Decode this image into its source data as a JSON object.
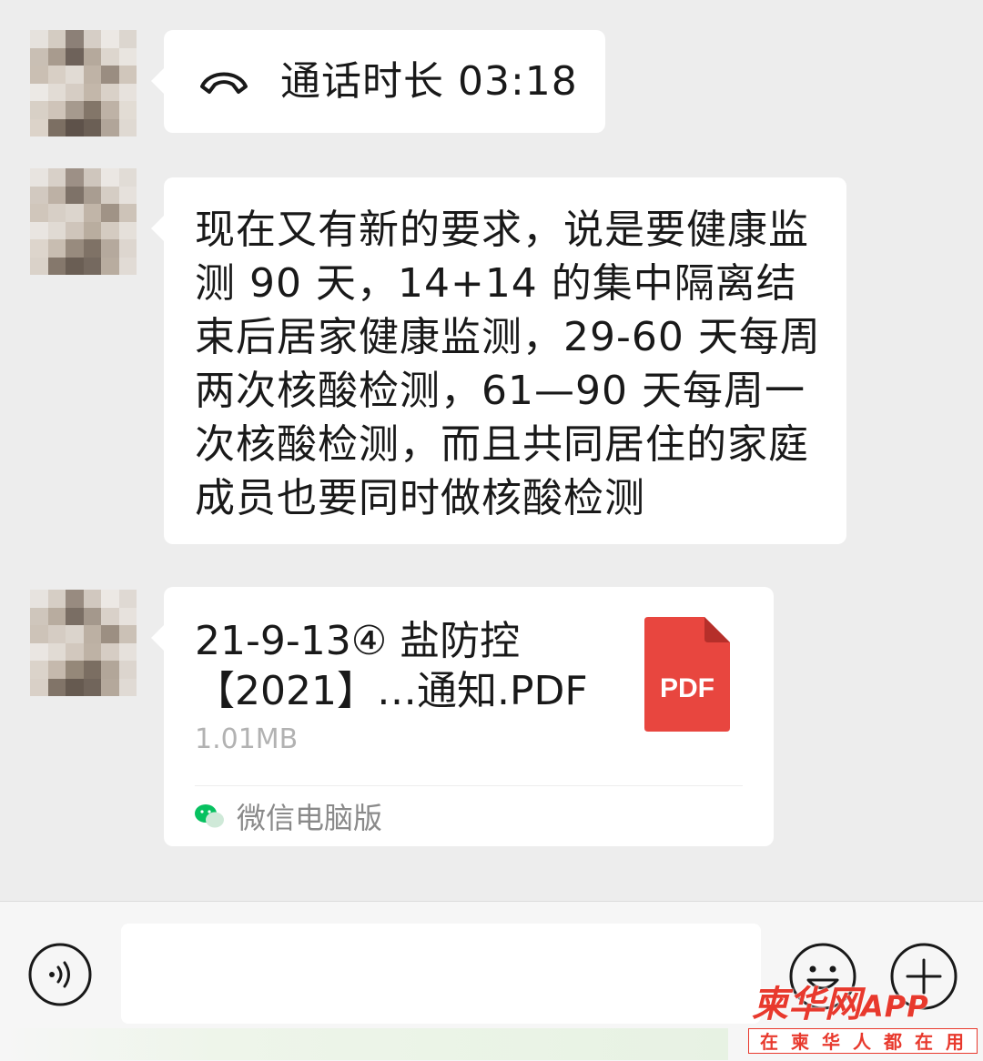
{
  "chat": {
    "call": {
      "text": "通话时长 03:18"
    },
    "message": {
      "text": "现在又有新的要求，说是要健康监测 90 天，14+14 的集中隔离结束后居家健康监测，29-60 天每周两次核酸检测，61—90 天每周一次核酸检测，而且共同居住的家庭成员也要同时做核酸检测"
    },
    "file": {
      "name_line1": "21-9-13④ 盐防控",
      "name_line2": "【2021】…通知.PDF",
      "size": "1.01MB",
      "type_label": "PDF",
      "source": "微信电脑版"
    }
  },
  "input_bar": {
    "input_value": "",
    "input_placeholder": ""
  },
  "watermark": {
    "title": "柬华网",
    "app": "APP",
    "subtitle": "在柬华人都在用"
  },
  "colors": {
    "background": "#ededed",
    "bubble": "#ffffff",
    "pdf_red": "#e8463f",
    "watermark_red": "#e8392d",
    "wechat_green": "#07c160"
  },
  "icons": {
    "call": "phone-handset-icon",
    "pdf": "pdf-file-icon",
    "source": "wechat-icon",
    "voice": "voice-icon",
    "emoji": "emoji-icon",
    "plus": "plus-icon"
  }
}
